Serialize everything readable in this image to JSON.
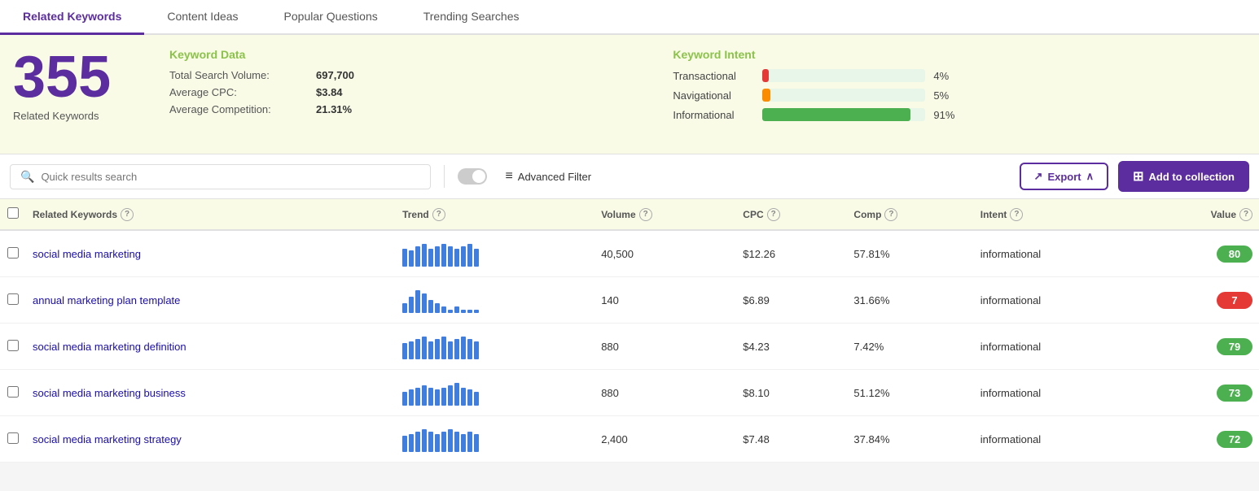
{
  "tabs": [
    {
      "id": "related-keywords",
      "label": "Related Keywords",
      "active": true
    },
    {
      "id": "content-ideas",
      "label": "Content Ideas",
      "active": false
    },
    {
      "id": "popular-questions",
      "label": "Popular Questions",
      "active": false
    },
    {
      "id": "trending-searches",
      "label": "Trending Searches",
      "active": false
    }
  ],
  "summary": {
    "count": "355",
    "count_label": "Related Keywords",
    "keyword_data_title": "Keyword Data",
    "total_search_volume_label": "Total Search Volume:",
    "total_search_volume_value": "697,700",
    "avg_cpc_label": "Average CPC:",
    "avg_cpc_value": "$3.84",
    "avg_competition_label": "Average Competition:",
    "avg_competition_value": "21.31%"
  },
  "intent": {
    "title": "Keyword Intent",
    "items": [
      {
        "label": "Transactional",
        "pct": 4,
        "color": "#e53935"
      },
      {
        "label": "Navigational",
        "pct": 5,
        "color": "#fb8c00"
      },
      {
        "label": "Informational",
        "pct": 91,
        "color": "#4caf50"
      }
    ]
  },
  "toolbar": {
    "search_placeholder": "Quick results search",
    "advanced_filter_label": "Advanced Filter",
    "export_label": "Export",
    "add_collection_label": "Add to collection"
  },
  "table": {
    "headers": [
      {
        "id": "checkbox",
        "label": ""
      },
      {
        "id": "keyword",
        "label": "Related Keywords",
        "has_info": true
      },
      {
        "id": "trend",
        "label": "Trend",
        "has_info": true
      },
      {
        "id": "volume",
        "label": "Volume",
        "has_info": true
      },
      {
        "id": "cpc",
        "label": "CPC",
        "has_info": true
      },
      {
        "id": "comp",
        "label": "Comp",
        "has_info": true
      },
      {
        "id": "intent",
        "label": "Intent",
        "has_info": true
      },
      {
        "id": "value",
        "label": "Value",
        "has_info": true
      }
    ],
    "rows": [
      {
        "keyword": "social media marketing",
        "trend_bars": [
          8,
          7,
          9,
          10,
          8,
          9,
          10,
          9,
          8,
          9,
          10,
          8
        ],
        "volume": "40,500",
        "cpc": "$12.26",
        "comp": "57.81%",
        "intent": "informational",
        "value": 80,
        "value_color": "badge-green"
      },
      {
        "keyword": "annual marketing plan template",
        "trend_bars": [
          3,
          5,
          7,
          6,
          4,
          3,
          2,
          1,
          2,
          1,
          1,
          1
        ],
        "volume": "140",
        "cpc": "$6.89",
        "comp": "31.66%",
        "intent": "informational",
        "value": 7,
        "value_color": "badge-orange"
      },
      {
        "keyword": "social media marketing definition",
        "trend_bars": [
          7,
          8,
          9,
          10,
          8,
          9,
          10,
          8,
          9,
          10,
          9,
          8
        ],
        "volume": "880",
        "cpc": "$4.23",
        "comp": "7.42%",
        "intent": "informational",
        "value": 79,
        "value_color": "badge-green"
      },
      {
        "keyword": "social media marketing business",
        "trend_bars": [
          6,
          7,
          8,
          9,
          8,
          7,
          8,
          9,
          10,
          8,
          7,
          6
        ],
        "volume": "880",
        "cpc": "$8.10",
        "comp": "51.12%",
        "intent": "informational",
        "value": 73,
        "value_color": "badge-green"
      },
      {
        "keyword": "social media marketing strategy",
        "trend_bars": [
          7,
          8,
          9,
          10,
          9,
          8,
          9,
          10,
          9,
          8,
          9,
          8
        ],
        "volume": "2,400",
        "cpc": "$7.48",
        "comp": "37.84%",
        "intent": "informational",
        "value": 72,
        "value_color": "badge-green"
      }
    ]
  },
  "icons": {
    "search": "🔍",
    "filter": "≡",
    "export": "↗",
    "add": "＋",
    "chevron_up": "∧",
    "info": "?"
  }
}
